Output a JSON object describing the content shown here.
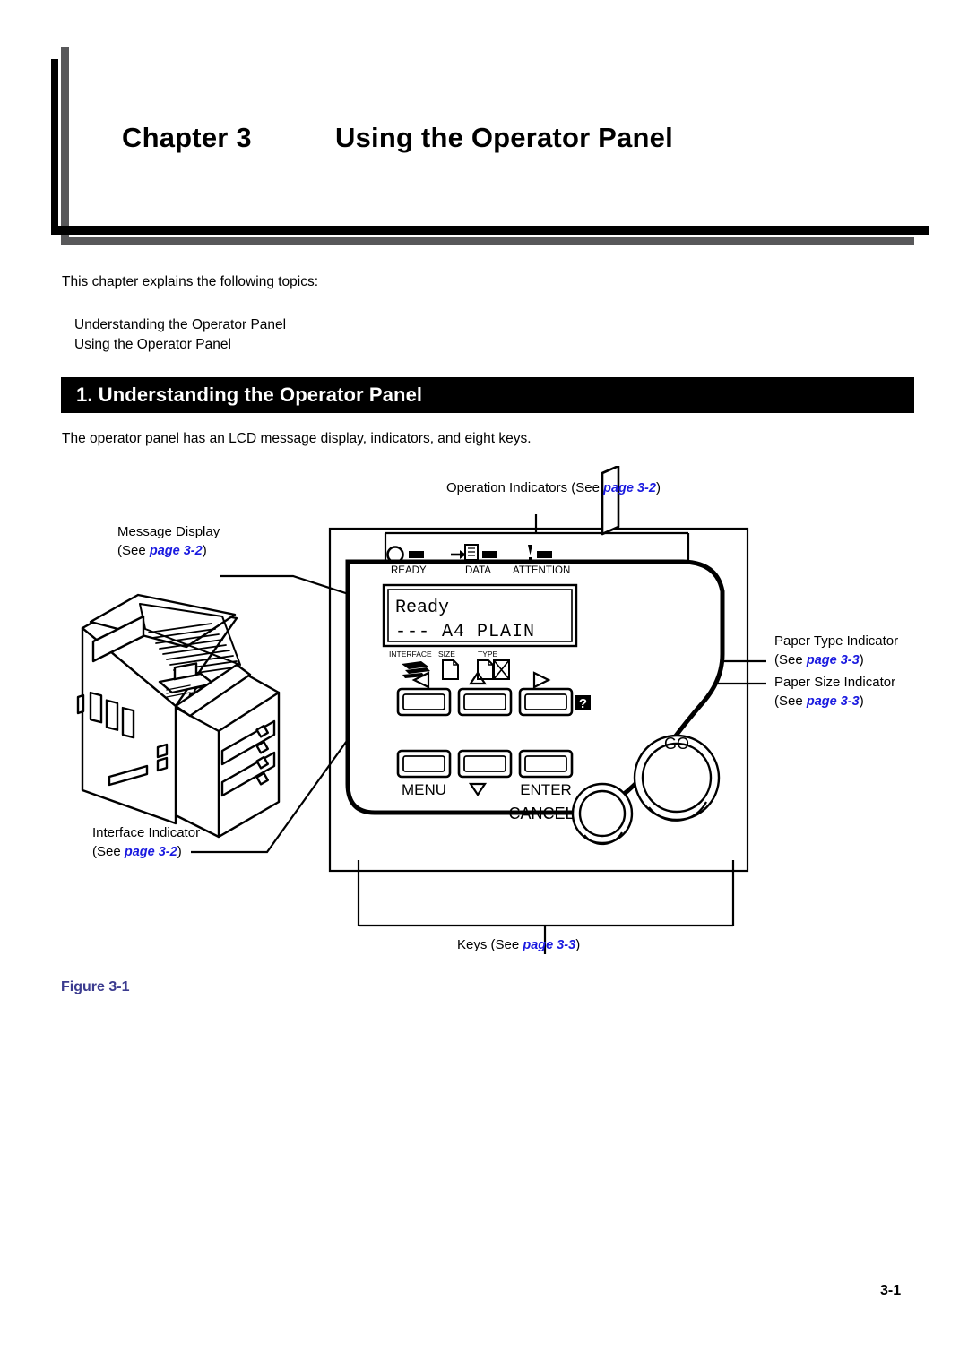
{
  "document": {
    "chapter_label": "Chapter 3",
    "chapter_title": "Using the Operator Panel",
    "intro": "This chapter explains the following topics:",
    "topics": [
      "Understanding the Operator Panel",
      "Using the Operator Panel"
    ],
    "section_heading": "1. Understanding the Operator Panel",
    "section_intro": "The operator panel has an LCD message display, indicators, and eight keys.",
    "figure_caption": "Figure 3-1",
    "page_number": "3-1"
  },
  "figure": {
    "callouts": {
      "operation_indicators": {
        "text": "Operation Indicators (See ",
        "xref": "page 3-2",
        "close": ")"
      },
      "message_display": {
        "line1": "Message Display",
        "line2_open": "(See ",
        "xref": "page 3-2",
        "close": ")"
      },
      "paper_type": {
        "line1": "Paper Type Indicator",
        "line2_open": "(See ",
        "xref": "page 3-3",
        "close": ")"
      },
      "paper_size": {
        "line1": "Paper Size Indicator",
        "line2_open": "(See ",
        "xref": "page 3-3",
        "close": ")"
      },
      "interface_indicator": {
        "line1": "Interface Indicator",
        "line2_open": "(See ",
        "xref": "page 3-2",
        "close": ")"
      },
      "keys": {
        "text": "Keys (See ",
        "xref": "page 3-3",
        "close": ")"
      }
    },
    "panel": {
      "indicators": [
        {
          "name": "READY",
          "icon": "circle-icon"
        },
        {
          "name": "DATA",
          "icon": "data-page-icon"
        },
        {
          "name": "ATTENTION",
          "icon": "exclamation-icon"
        }
      ],
      "lcd": {
        "line1": "Ready",
        "line2": "---  A4 PLAIN"
      },
      "status_icons": [
        {
          "label": "INTERFACE",
          "icon": "interface-icon"
        },
        {
          "label": "SIZE",
          "icon": "paper-size-icon"
        },
        {
          "label": "TYPE",
          "icon": "paper-type-icon"
        }
      ],
      "keys_row1": [
        {
          "label": "",
          "glyph": "◁",
          "name": "left-arrow-key"
        },
        {
          "label": "",
          "glyph": "△",
          "name": "up-arrow-key"
        },
        {
          "label": "",
          "glyph": "▷",
          "name": "right-arrow-key"
        }
      ],
      "keys_row2": [
        {
          "label": "MENU",
          "glyph": "",
          "name": "menu-key"
        },
        {
          "label": "",
          "glyph": "▽",
          "name": "down-arrow-key"
        },
        {
          "label": "ENTER",
          "glyph": "",
          "name": "enter-key"
        }
      ],
      "round_keys": [
        {
          "label": "GO",
          "name": "go-key"
        },
        {
          "label": "CANCEL",
          "name": "cancel-key"
        }
      ],
      "help_badge": "?"
    },
    "colors": {
      "xref_blue": "#1a1ae0",
      "caption_blue": "#3b3b8f",
      "rule_gray": "#58585a"
    }
  }
}
